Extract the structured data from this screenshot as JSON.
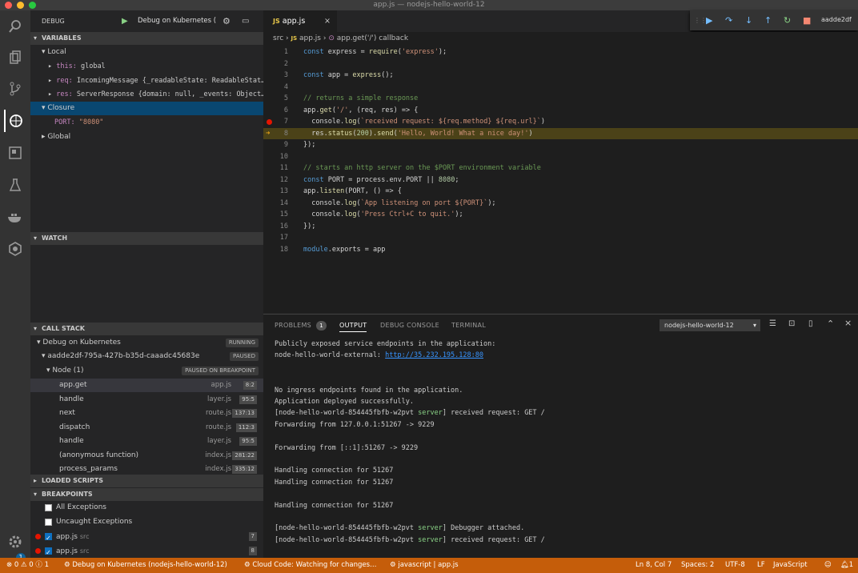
{
  "window": {
    "title": "app.js — nodejs-hello-world-12"
  },
  "sidebar": {
    "title": "DEBUG",
    "config": "Debug on Kubernetes (",
    "variables": {
      "header": "VARIABLES",
      "local_label": "Local",
      "items": [
        {
          "key": "this:",
          "val": "global"
        },
        {
          "key": "req:",
          "val": "IncomingMessage {_readableState: ReadableStat…"
        },
        {
          "key": "res:",
          "val": "ServerResponse {domain: null, _events: Object…"
        }
      ],
      "closure_label": "Closure",
      "closure_port_key": "PORT:",
      "closure_port_val": "\"8080\"",
      "global_label": "Global"
    },
    "watch": {
      "header": "WATCH"
    },
    "callstack": {
      "header": "CALL STACK",
      "session": "Debug on Kubernetes",
      "session_state": "RUNNING",
      "thread": "aadde2df-795a-427b-b35d-caaadc45683e",
      "thread_state": "PAUSED",
      "node": "Node (1)",
      "node_state": "PAUSED ON BREAKPOINT",
      "frames": [
        {
          "fn": "app.get",
          "file": "app.js",
          "line": "8:2"
        },
        {
          "fn": "handle",
          "file": "layer.js",
          "line": "95:5"
        },
        {
          "fn": "next",
          "file": "route.js",
          "line": "137:13"
        },
        {
          "fn": "dispatch",
          "file": "route.js",
          "line": "112:3"
        },
        {
          "fn": "handle",
          "file": "layer.js",
          "line": "95:5"
        },
        {
          "fn": "(anonymous function)",
          "file": "index.js",
          "line": "281:22"
        },
        {
          "fn": "process_params",
          "file": "index.js",
          "line": "335:12"
        }
      ]
    },
    "loaded": {
      "header": "LOADED SCRIPTS"
    },
    "breakpoints": {
      "header": "BREAKPOINTS",
      "all": "All Exceptions",
      "uncaught": "Uncaught Exceptions",
      "items": [
        {
          "file": "app.js",
          "dir": "src",
          "line": "7"
        },
        {
          "file": "app.js",
          "dir": "src",
          "line": "8"
        }
      ]
    }
  },
  "editor": {
    "tab": "app.js",
    "breadcrumb": [
      "src",
      "app.js",
      "app.get('/') callback"
    ],
    "lines": [
      {
        "n": "1",
        "code": "const express = require('express');"
      },
      {
        "n": "2",
        "code": ""
      },
      {
        "n": "3",
        "code": "const app = express();"
      },
      {
        "n": "4",
        "code": ""
      },
      {
        "n": "5",
        "code": "// returns a simple response"
      },
      {
        "n": "6",
        "code": "app.get('/', (req, res) => {"
      },
      {
        "n": "7",
        "code": "  console.log(`received request: ${req.method} ${req.url}`)"
      },
      {
        "n": "8",
        "code": "  res.status(200).send('Hello, World! What a nice day!')"
      },
      {
        "n": "9",
        "code": "});"
      },
      {
        "n": "10",
        "code": ""
      },
      {
        "n": "11",
        "code": "// starts an http server on the $PORT environment variable"
      },
      {
        "n": "12",
        "code": "const PORT = process.env.PORT || 8080;"
      },
      {
        "n": "13",
        "code": "app.listen(PORT, () => {"
      },
      {
        "n": "14",
        "code": "  console.log(`App listening on port ${PORT}`);"
      },
      {
        "n": "15",
        "code": "  console.log('Press Ctrl+C to quit.');"
      },
      {
        "n": "16",
        "code": "});"
      },
      {
        "n": "17",
        "code": ""
      },
      {
        "n": "18",
        "code": "module.exports = app"
      }
    ]
  },
  "debug_toolbar": {
    "target": "aadde2df"
  },
  "panel": {
    "tabs": [
      "PROBLEMS",
      "OUTPUT",
      "DEBUG CONSOLE",
      "TERMINAL"
    ],
    "problems_count": "1",
    "channel": "nodejs-hello-world-12",
    "output": [
      "Publicly exposed service endpoints in the application:",
      "node-hello-world-external: http://35.232.195.128:80",
      "",
      "",
      "No ingress endpoints found in the application.",
      "Application deployed successfully.",
      "[node-hello-world-854445fbfb-w2pvt server] received request: GET /",
      "Forwarding from 127.0.0.1:51267 -> 9229",
      "",
      "Forwarding from [::1]:51267 -> 9229",
      "",
      "Handling connection for 51267",
      "Handling connection for 51267",
      "",
      "Handling connection for 51267",
      "",
      "[node-hello-world-854445fbfb-w2pvt server] Debugger attached.",
      "[node-hello-world-854445fbfb-w2pvt server] received request: GET /"
    ],
    "link": "http://35.232.195.128:80"
  },
  "status": {
    "errors": "0",
    "warnings": "0",
    "info": "1",
    "debug": "Debug on Kubernetes (nodejs-hello-world-12)",
    "cloud": "Cloud Code: Watching for changes…",
    "file": "javascript | app.js",
    "pos": "Ln 8, Col 7",
    "spaces": "Spaces: 2",
    "enc": "UTF-8",
    "eol": "LF",
    "lang": "JavaScript",
    "bell": "1"
  },
  "colors": {
    "accent": "#c55d0a",
    "highlight": "#5a4a1e",
    "selection": "#094771"
  }
}
